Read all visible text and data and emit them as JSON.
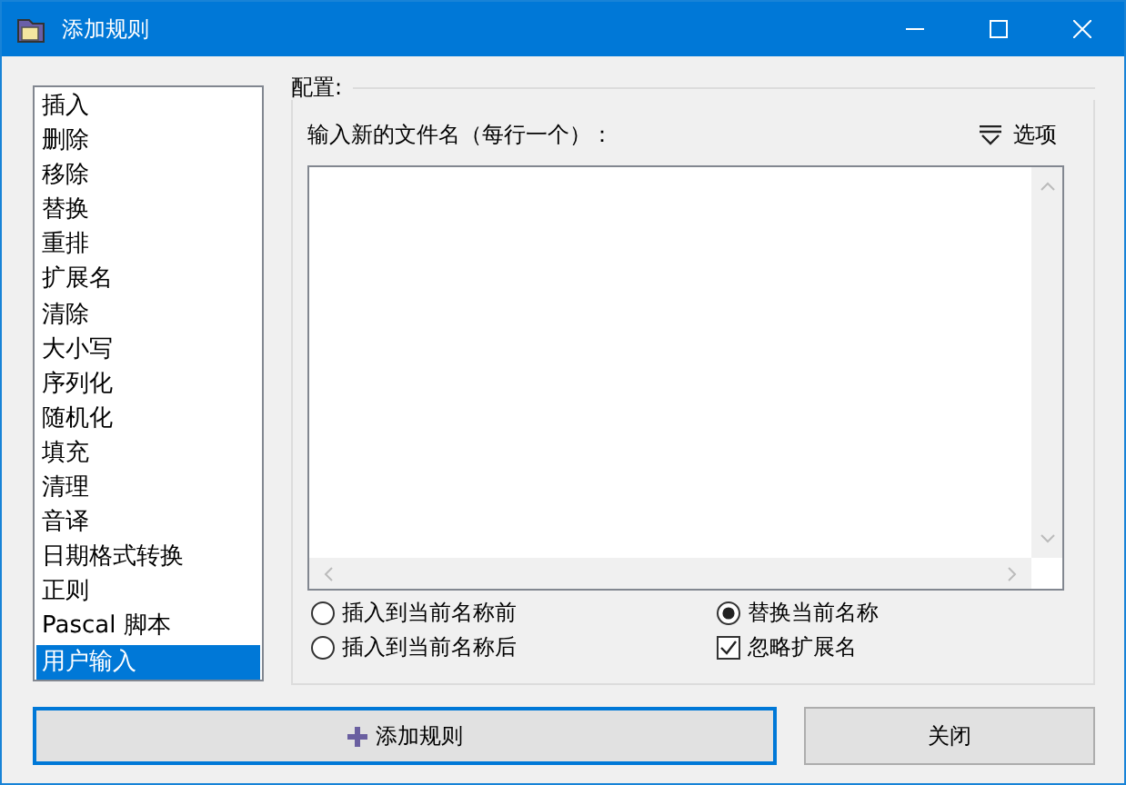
{
  "window": {
    "title": "添加规则"
  },
  "rules": [
    {
      "label": "插入",
      "selected": false
    },
    {
      "label": "删除",
      "selected": false
    },
    {
      "label": "移除",
      "selected": false
    },
    {
      "label": "替换",
      "selected": false
    },
    {
      "label": "重排",
      "selected": false
    },
    {
      "label": "扩展名",
      "selected": false
    },
    {
      "label": "清除",
      "selected": false
    },
    {
      "label": "大小写",
      "selected": false
    },
    {
      "label": "序列化",
      "selected": false
    },
    {
      "label": "随机化",
      "selected": false
    },
    {
      "label": "填充",
      "selected": false
    },
    {
      "label": "清理",
      "selected": false
    },
    {
      "label": "音译",
      "selected": false
    },
    {
      "label": "日期格式转换",
      "selected": false
    },
    {
      "label": "正则",
      "selected": false
    },
    {
      "label": "Pascal 脚本",
      "selected": false
    },
    {
      "label": "用户输入",
      "selected": true
    }
  ],
  "config": {
    "title": "配置:",
    "prompt": "输入新的文件名（每行一个）：",
    "options_button": "选项",
    "choices": [
      {
        "kind": "radio",
        "label": "插入到当前名称前",
        "selected": false
      },
      {
        "kind": "radio",
        "label": "替换当前名称",
        "selected": true
      },
      {
        "kind": "radio",
        "label": "插入到当前名称后",
        "selected": false
      },
      {
        "kind": "checkbox",
        "label": "忽略扩展名",
        "checked": true
      }
    ]
  },
  "buttons": [
    {
      "label": "添加规则",
      "focused": true
    },
    {
      "label": "关闭",
      "focused": false
    }
  ]
}
